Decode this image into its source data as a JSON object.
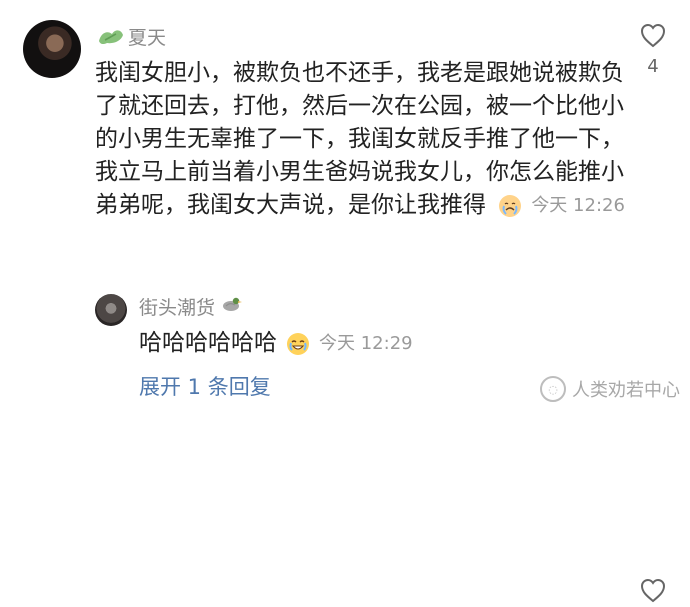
{
  "comment": {
    "author": "夏天",
    "text": "我闺女胆小，被欺负也不还手，我老是跟她说被欺负了就还回去，打他，然后一次在公园，被一个比他小的小男生无辜推了一下，我闺女就反手推了他一下，我立马上前当着小男生爸妈说我女儿，你怎么能推小弟弟呢，我闺女大声说，是你让我推得",
    "time": "今天 12:26",
    "likes": "4"
  },
  "reply": {
    "author": "街头潮货",
    "text": "哈哈哈哈哈哈",
    "time": "今天 12:29",
    "likes": ""
  },
  "expand_replies": "展开 1 条回复",
  "watermark": "人类劝若中心",
  "colors": {
    "text": "#222222",
    "meta": "#9a9a9a",
    "link": "#4f78ad"
  },
  "icons": {
    "badge": "leaf-badge-icon",
    "main_like": "heart-outline-icon",
    "reply_like": "heart-outline-icon",
    "emoji_main": "crying-face-icon",
    "emoji_reply": "laughing-face-icon",
    "reply_badge": "duck-icon",
    "watermark_logo": "weibo-logo-icon"
  }
}
